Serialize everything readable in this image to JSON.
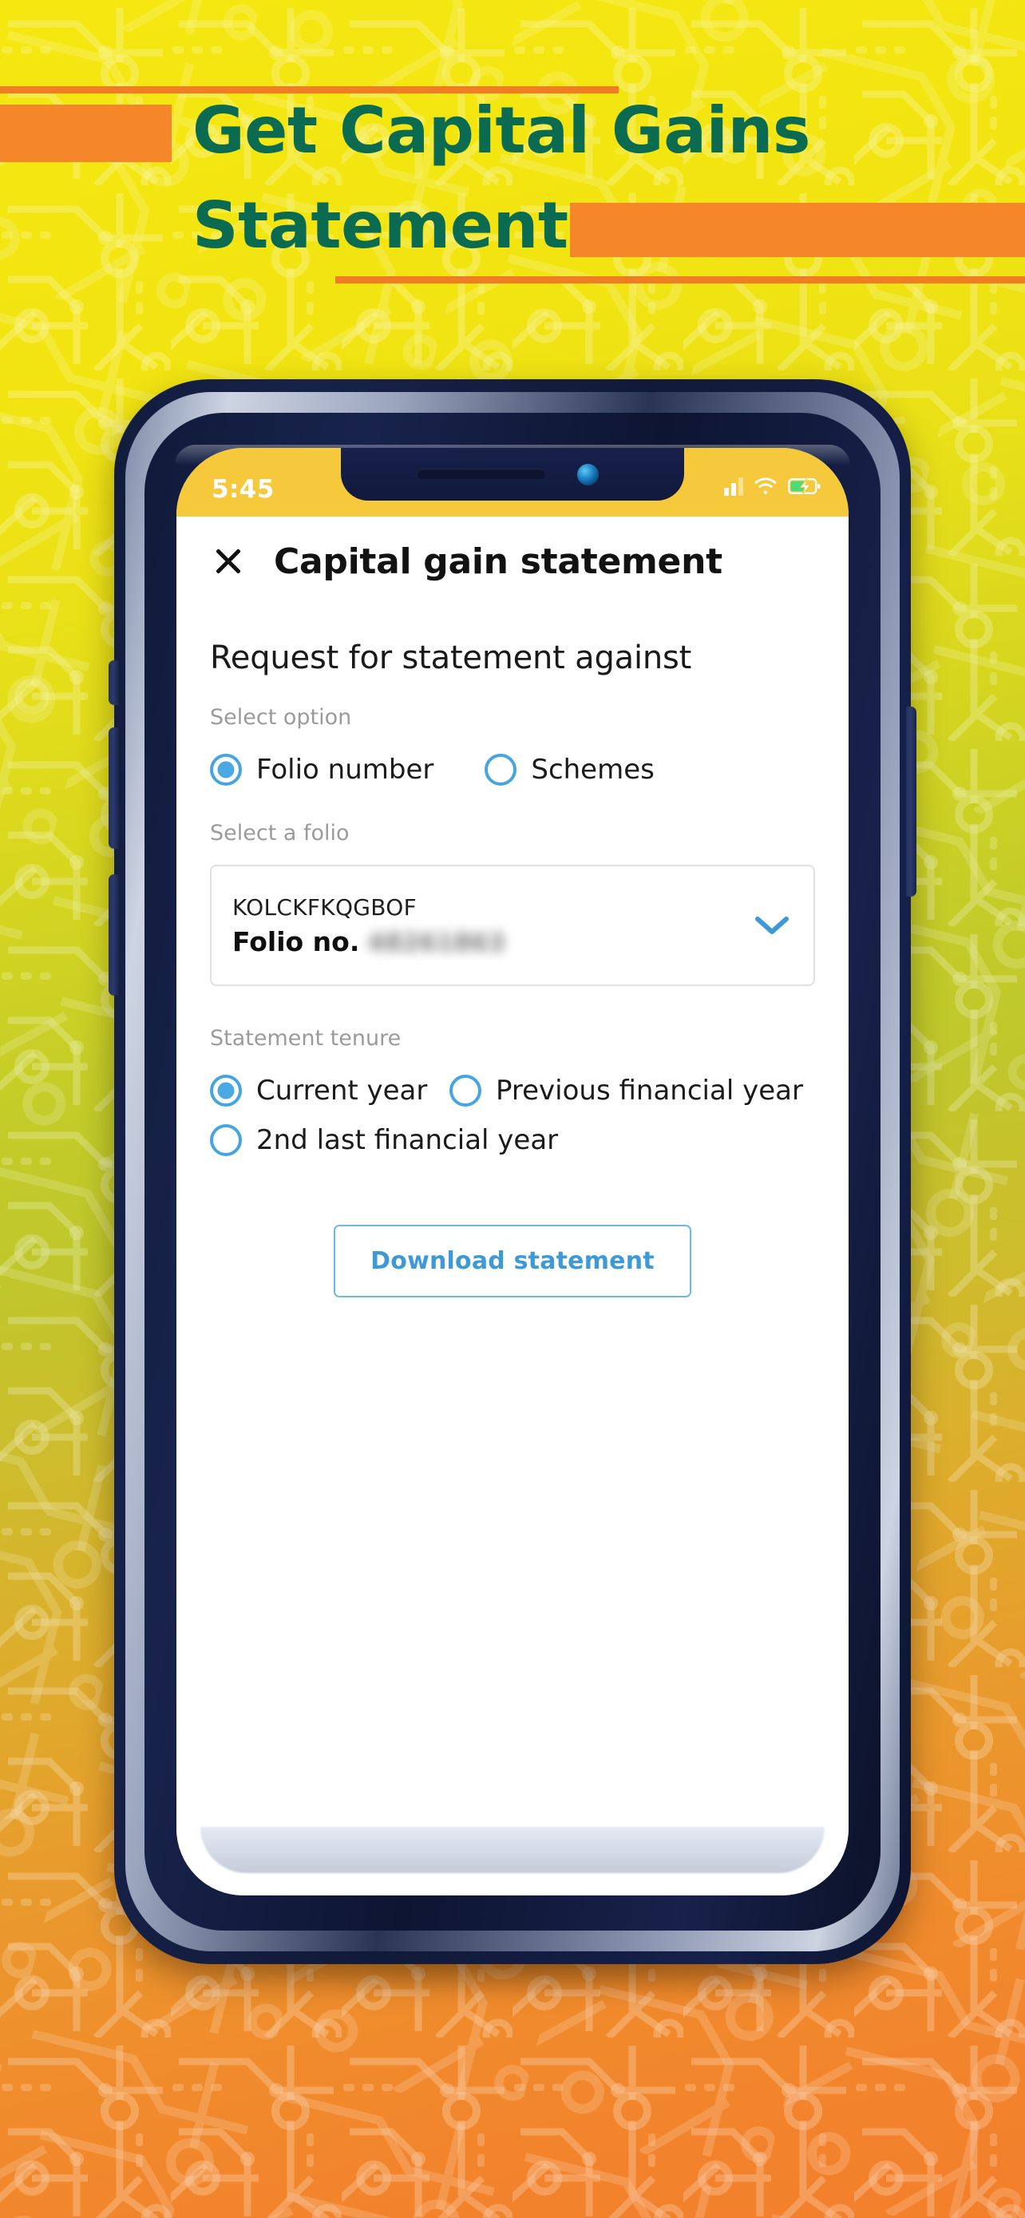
{
  "banner": {
    "title_line1": "Get Capital Gains",
    "title_line2": "Statement",
    "title_color": "#0a6b50",
    "accent_color": "#f5862a"
  },
  "phone": {
    "status_bar": {
      "time": "5:45",
      "signal_icon": "signal-bars-icon",
      "wifi_icon": "wifi-icon",
      "battery_icon": "battery-charging-icon",
      "background_color": "#f6c83c"
    },
    "notch": {
      "speaker_icon": "earpiece-speaker-icon",
      "camera_icon": "front-camera-icon"
    },
    "side_buttons": {
      "mute": "mute-switch",
      "volume_down": "volume-down-button",
      "volume_up": "volume-up-button",
      "power": "power-button"
    }
  },
  "app": {
    "header": {
      "close_icon": "close-icon",
      "title": "Capital gain statement"
    },
    "section_heading": "Request for statement against",
    "option_group": {
      "label": "Select option",
      "options": [
        {
          "label": "Folio number",
          "selected": true
        },
        {
          "label": "Schemes",
          "selected": false
        }
      ]
    },
    "folio_group": {
      "label": "Select a folio",
      "card": {
        "code": "KOLCKFKQGBOF",
        "folio_no_label": "Folio no.",
        "folio_no_value": "48261863",
        "chevron_icon": "chevron-down-icon",
        "chevron_color": "#3d9ad6"
      }
    },
    "tenure_group": {
      "label": "Statement tenure",
      "options": [
        {
          "label": "Current year",
          "selected": true
        },
        {
          "label": "Previous financial year",
          "selected": false
        },
        {
          "label": "2nd last financial year",
          "selected": false
        }
      ]
    },
    "download_button": {
      "label": "Download statement",
      "color": "#3d9ad6"
    },
    "accent_color": "#46a5e0"
  }
}
